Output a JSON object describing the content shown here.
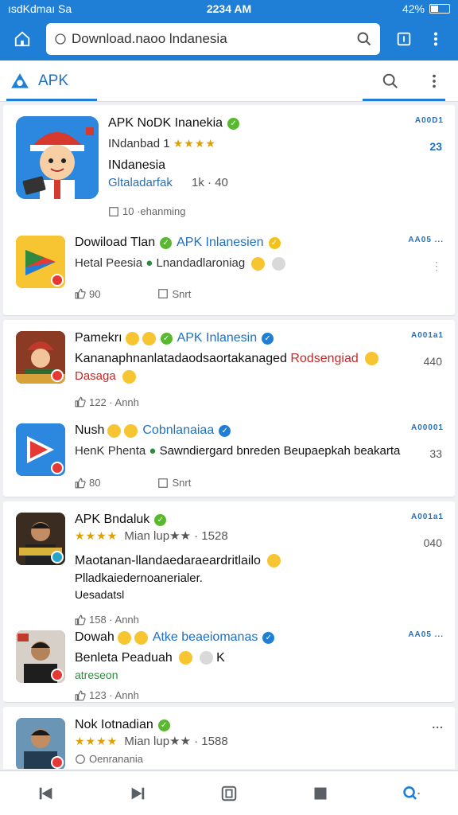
{
  "status": {
    "carrier": "ısdKdmaı Sa",
    "time": "2234 AM",
    "battery": "42%"
  },
  "browser": {
    "url_text": "Download.naoo lndanesia"
  },
  "tabbar": {
    "title": "APK"
  },
  "feed": [
    {
      "name": "APK NoDK Inanekia",
      "subtitle": "INdanbad 1",
      "rating_stars": "★★★★",
      "title2": "INdanesia",
      "desc": "Gltaladarfak",
      "extra": "1k · 40",
      "meta_left": "10 ·ehanming",
      "side_code": "A00D1",
      "side_value": "23"
    },
    {
      "name": "Dowiload Tlan",
      "subtitle": "APK Inlanesien",
      "desc": "Hetal Peesia",
      "desc2": "Lnandadlaroniag",
      "likes": "90",
      "save": "Snrt",
      "side_code": "AA05 ..."
    },
    {
      "name": "Pamekrı",
      "subtitle": "APK Inlanesin",
      "desc": "Kananaphnanlatadaodsaortakanaged",
      "desc_red": "Rodsengiad",
      "desc3": "Dasaga",
      "likes": "122 · Annh",
      "side_code": "A001a1",
      "side_value": "440"
    },
    {
      "name": "Nush",
      "subtitle": "Cobnlanaiaa",
      "desc": "HenK Phenta",
      "desc2": "Sawndiergard bnreden Beupaepkah beakarta",
      "likes": "80",
      "save": "Snrt",
      "side_code": "A00001",
      "side_value": "33"
    },
    {
      "name": "APK Bndaluk",
      "rating_stars": "★★★★",
      "rating_text": "Mian lup★★ · 1528",
      "desc": "Maotanan-llandaedaraeardritlailo",
      "desc2": "Plladkaiedernoanerialer.",
      "desc3": "Uesadatsl",
      "likes": "158 · Annh",
      "side_code": "A001a1",
      "side_value": "040"
    },
    {
      "name": "Dowah",
      "subtitle": "Atke beaeiomanas",
      "desc": "Benleta Peaduah",
      "desc_extra": "K",
      "desc3": "atreseon",
      "likes": "123 · Annh",
      "side_code": "AA05 ..."
    },
    {
      "name": "Nok Iotnadian",
      "rating_text": "Mian lup★★ · 1588",
      "meta_left": "Oenranania",
      "side_code": "..."
    }
  ],
  "colors": {
    "brand_blue": "#1f7fd6",
    "link_blue": "#1f6fc2",
    "badge_red": "#e53935",
    "star_gold": "#e0a000",
    "verify_green": "#58b82e"
  },
  "icons": [
    "home-icon",
    "search-icon",
    "tabs-icon",
    "menu-icon",
    "apk-logo-icon",
    "back-icon",
    "forward-icon",
    "square-icon",
    "stop-icon"
  ]
}
